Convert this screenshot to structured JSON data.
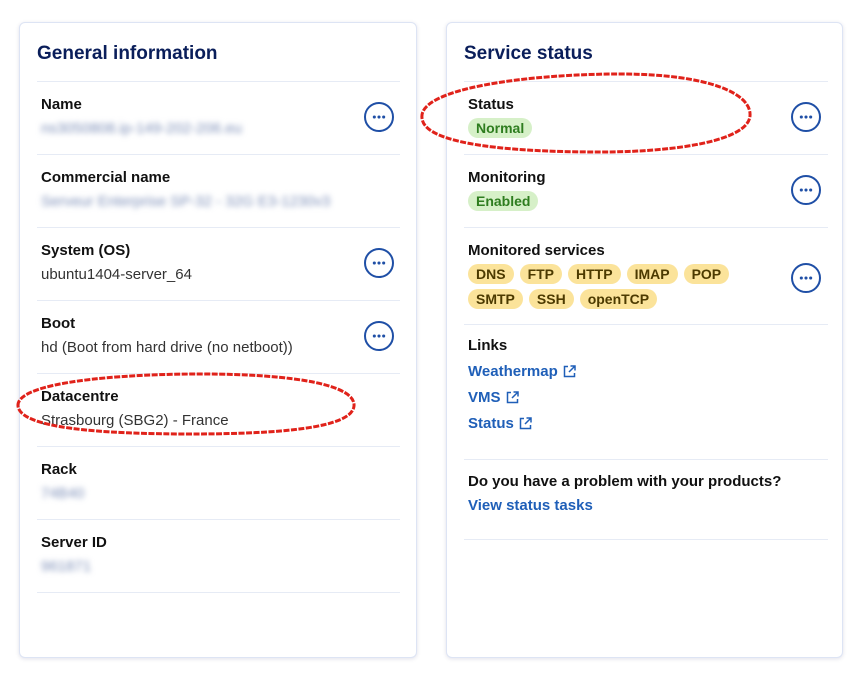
{
  "general": {
    "title": "General information",
    "rows": [
      {
        "label": "Name",
        "value": "ns3050808.ip-149-202-206.eu"
      },
      {
        "label": "Commercial name",
        "value": "Serveur Enterprise SP-32 - 32G E3-1230v3"
      },
      {
        "label": "System (OS)",
        "value": "ubuntu1404-server_64"
      },
      {
        "label": "Boot",
        "value": "hd (Boot from hard drive (no netboot))"
      },
      {
        "label": "Datacentre",
        "value": "Strasbourg (SBG2) - France"
      },
      {
        "label": "Rack",
        "value": "74B40"
      },
      {
        "label": "Server ID",
        "value": "961871"
      }
    ]
  },
  "service": {
    "title": "Service status",
    "status": {
      "label": "Status",
      "badge": "Normal"
    },
    "monitoring": {
      "label": "Monitoring",
      "badge": "Enabled"
    },
    "monitored": {
      "label": "Monitored services",
      "items": [
        "DNS",
        "FTP",
        "HTTP",
        "IMAP",
        "POP",
        "SMTP",
        "SSH",
        "openTCP"
      ]
    },
    "links": {
      "label": "Links",
      "items": [
        "Weathermap",
        "VMS",
        "Status"
      ]
    },
    "problem": {
      "question": "Do you have a problem with your products?",
      "link": "View status tasks"
    }
  },
  "colors": {
    "title": "#0a1e5a",
    "accent": "#1f4fa6",
    "link": "#1f5fb8",
    "badge_ok_bg": "#d6f0c8",
    "badge_service_bg": "#fbe39a",
    "annotation": "#e0221a"
  },
  "icons": {
    "more": "more-dots-icon",
    "external": "external-link-icon"
  }
}
